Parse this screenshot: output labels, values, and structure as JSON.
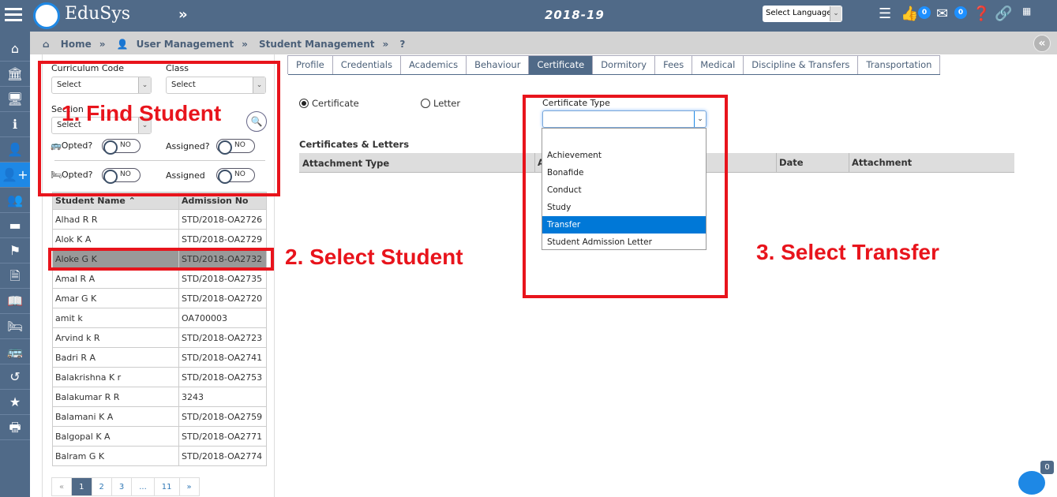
{
  "header": {
    "brand": "EduSys",
    "year": "2018-19",
    "language_select": "Select Language",
    "likes_count": "0",
    "messages_count": "0"
  },
  "sidebar": {
    "items": [
      {
        "icon": "home-icon"
      },
      {
        "icon": "bank-icon"
      },
      {
        "icon": "monitor-icon"
      },
      {
        "icon": "info-icon"
      },
      {
        "icon": "user-icon"
      },
      {
        "icon": "user-plus-icon",
        "active": true
      },
      {
        "icon": "users-icon"
      },
      {
        "icon": "credit-card-icon"
      },
      {
        "icon": "flag-icon"
      },
      {
        "icon": "file-icon"
      },
      {
        "icon": "book-icon"
      },
      {
        "icon": "bed-icon"
      },
      {
        "icon": "bus-icon"
      },
      {
        "icon": "history-icon"
      },
      {
        "icon": "star-icon"
      },
      {
        "icon": "print-icon"
      }
    ]
  },
  "breadcrumb": {
    "home": "Home",
    "user_management": "User Management",
    "student_management": "Student Management",
    "help": "?"
  },
  "filters": {
    "curriculum_label": "Curriculum Code",
    "curriculum_value": "Select",
    "class_label": "Class",
    "class_value": "Select",
    "section_label": "Section",
    "section_value": "Select",
    "bus_opted_label": "Opted?",
    "bus_opted": "NO",
    "bus_assigned_label": "Assigned?",
    "bus_assigned": "NO",
    "hostel_opted_label": "Opted?",
    "hostel_opted": "NO",
    "hostel_assigned_label": "Assigned",
    "hostel_assigned": "NO"
  },
  "students": {
    "headers": [
      "Student Name",
      "Admission No"
    ],
    "sort_icon": "chevron-up-icon",
    "rows": [
      [
        "Alhad R R",
        "STD/2018-OA2726"
      ],
      [
        "Alok K A",
        "STD/2018-OA2729"
      ],
      [
        "Aloke G K",
        "STD/2018-OA2732"
      ],
      [
        "Amal R A",
        "STD/2018-OA2735"
      ],
      [
        "Amar G K",
        "STD/2018-OA2720"
      ],
      [
        "amit k",
        "OA700003"
      ],
      [
        "Arvind k R",
        "STD/2018-OA2723"
      ],
      [
        "Badri R A",
        "STD/2018-OA2741"
      ],
      [
        "Balakrishna K r",
        "STD/2018-OA2753"
      ],
      [
        "Balakumar R R",
        "3243"
      ],
      [
        "Balamani K A",
        "STD/2018-OA2759"
      ],
      [
        "Balgopal K A",
        "STD/2018-OA2771"
      ],
      [
        "Balram G K",
        "STD/2018-OA2774"
      ]
    ],
    "selected": "Aloke G K"
  },
  "pagination": [
    "«",
    "1",
    "2",
    "3",
    "...",
    "11",
    "»"
  ],
  "tabs": [
    "Profile",
    "Credentials",
    "Academics",
    "Behaviour",
    "Certificate",
    "Dormitory",
    "Fees",
    "Medical",
    "Discipline & Transfers",
    "Transportation"
  ],
  "active_tab": "Certificate",
  "certificate": {
    "radio_certificate": "Certificate",
    "radio_letter": "Letter",
    "type_label": "Certificate Type",
    "type_value": "",
    "options": [
      "",
      "Achievement",
      "Bonafide",
      "Conduct",
      "Study",
      "Transfer",
      "Student Admission Letter"
    ],
    "highlighted": "Transfer",
    "section_title": "Certificates & Letters",
    "columns": [
      "Attachment Type",
      "A",
      "Date",
      "Attachment"
    ]
  },
  "annotations": {
    "step1": "1. Find Student",
    "step2": "2. Select Student",
    "step3": "3. Select Transfer",
    "color": "#e8141c"
  },
  "chat": {
    "badge": "0"
  },
  "colors": {
    "header": "#506a88",
    "accent": "#1e88e5",
    "highlight": "#0078d7"
  }
}
